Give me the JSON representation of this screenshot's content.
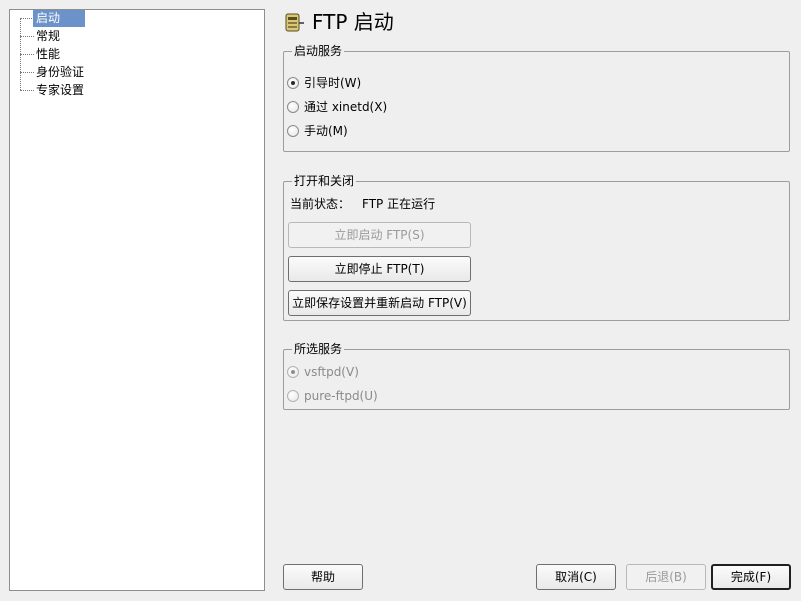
{
  "tree": [
    {
      "label": "启动",
      "selected": true
    },
    {
      "label": "常规"
    },
    {
      "label": "性能"
    },
    {
      "label": "身份验证"
    },
    {
      "label": "专家设置"
    }
  ],
  "header": {
    "title": "FTP 启动",
    "icon": "ftp-module-icon"
  },
  "startup": {
    "title": "启动服务",
    "options": [
      {
        "label": "引导时(W)",
        "checked": true
      },
      {
        "label": "通过 xinetd(X)"
      },
      {
        "label": "手动(M)"
      }
    ]
  },
  "toggle": {
    "title": "打开和关闭",
    "status_label": "当前状态：",
    "status_value": "FTP 正在运行",
    "start_label": "立即启动 FTP(S)",
    "stop_label": "立即停止 FTP(T)",
    "save_restart_label": "立即保存设置并重新启动 FTP(V)"
  },
  "selected_service": {
    "title": "所选服务",
    "options": [
      {
        "label": "vsftpd(V)",
        "checked": true
      },
      {
        "label": "pure-ftpd(U)"
      }
    ]
  },
  "footer": {
    "help": "帮助",
    "cancel": "取消(C)",
    "back": "后退(B)",
    "finish": "完成(F)"
  }
}
